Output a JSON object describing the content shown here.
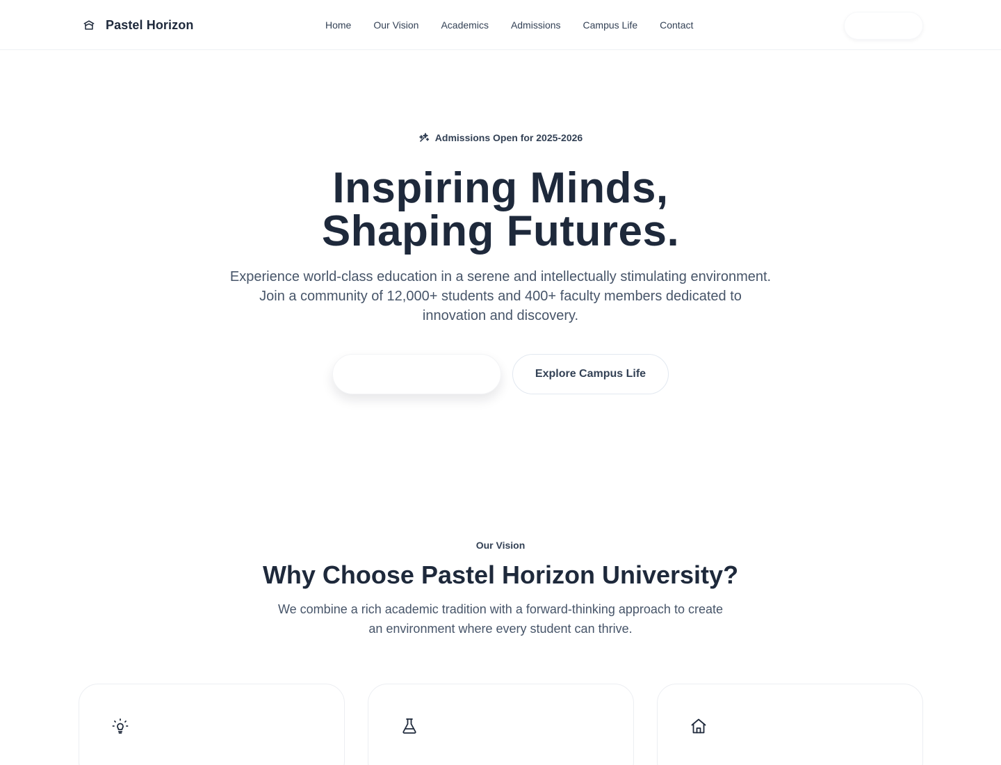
{
  "header": {
    "brand_name": "Pastel Horizon",
    "brand_icon": "graduation-cap-icon",
    "nav": [
      "Home",
      "Our Vision",
      "Academics",
      "Admissions",
      "Campus Life",
      "Contact"
    ],
    "cta_label": ""
  },
  "hero": {
    "badge_icon": "sparkles-icon",
    "badge": "Admissions Open for 2025-2026",
    "title_line1": "Inspiring Minds,",
    "title_line2": "Shaping Futures.",
    "subtitle": "Experience world-class education in a serene and intellectually stimulating environment. Join a community of 12,000+ students and 400+ faculty members dedicated to innovation and discovery.",
    "primary_button": "",
    "secondary_button": "Explore Campus Life"
  },
  "vision": {
    "eyebrow": "Our Vision",
    "title": "Why Choose Pastel Horizon University?",
    "subtitle": "We combine a rich academic tradition with a forward-thinking approach to create an environment where every student can thrive.",
    "cards": [
      {
        "icon": "lightbulb-icon"
      },
      {
        "icon": "flask-icon"
      },
      {
        "icon": "home-icon"
      }
    ]
  },
  "colors": {
    "text_dark": "#1e293b",
    "text_muted": "#475569",
    "border": "#e2e8f0"
  }
}
